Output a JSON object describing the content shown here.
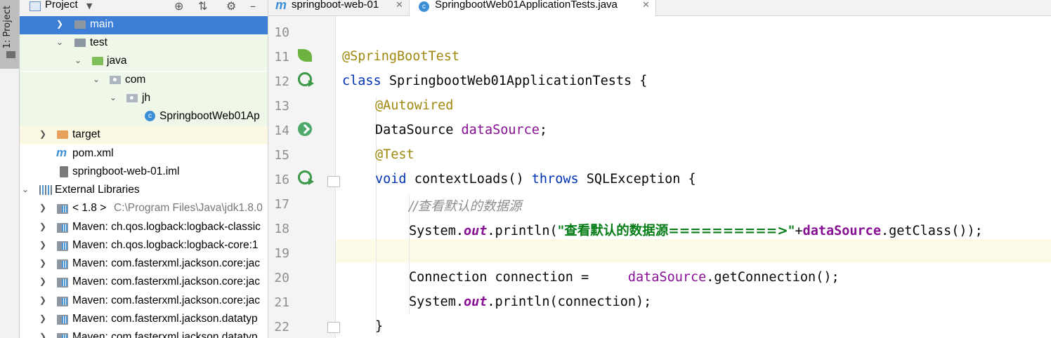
{
  "tool_window_strip": {
    "label": "1: Project"
  },
  "project_panel": {
    "title": "Project",
    "tree": [
      {
        "label": "main",
        "icon": "folder-icon",
        "expanded": false,
        "selected": true
      },
      {
        "label": "test",
        "icon": "folder-icon",
        "expanded": true
      },
      {
        "label": "java",
        "icon": "test-source-folder-icon",
        "expanded": true
      },
      {
        "label": "com",
        "icon": "package-icon",
        "expanded": true
      },
      {
        "label": "jh",
        "icon": "package-icon",
        "expanded": true
      },
      {
        "label": "SpringbootWeb01Ap",
        "icon": "class-icon"
      },
      {
        "label": "target",
        "icon": "excluded-folder-icon",
        "expanded": false
      },
      {
        "label": "pom.xml",
        "icon": "maven-icon"
      },
      {
        "label": "springboot-web-01.iml",
        "icon": "iml-file-icon"
      },
      {
        "label": "External Libraries",
        "icon": "libraries-icon",
        "expanded": true
      },
      {
        "label": "< 1.8 >",
        "detail": "C:\\Program Files\\Java\\jdk1.8.0",
        "icon": "jdk-icon"
      },
      {
        "label": "Maven: ch.qos.logback:logback-classic",
        "icon": "jar-icon"
      },
      {
        "label": "Maven: ch.qos.logback:logback-core:1",
        "icon": "jar-icon"
      },
      {
        "label": "Maven: com.fasterxml.jackson.core:jac",
        "icon": "jar-icon"
      },
      {
        "label": "Maven: com.fasterxml.jackson.core:jac",
        "icon": "jar-icon"
      },
      {
        "label": "Maven: com.fasterxml.jackson.core:jac",
        "icon": "jar-icon"
      },
      {
        "label": "Maven: com.fasterxml.jackson.datatyp",
        "icon": "jar-icon"
      },
      {
        "label": "Maven: com.fasterxml.jackson.datatyp",
        "icon": "jar-icon"
      }
    ]
  },
  "editor_tabs": [
    {
      "label": "springboot-web-01",
      "icon": "maven-icon",
      "active": false
    },
    {
      "label": "SpringbootWeb01ApplicationTests.java",
      "icon": "class-icon",
      "active": true
    }
  ],
  "code": {
    "line_numbers": [
      "10",
      "11",
      "12",
      "13",
      "14",
      "15",
      "16",
      "17",
      "18",
      "19",
      "20",
      "21",
      "22"
    ],
    "l11": {
      "ann": "@SpringBootTest"
    },
    "l12": {
      "kw": "class",
      "name": " SpringbootWeb01ApplicationTests {"
    },
    "l13": {
      "ann": "@Autowired"
    },
    "l14": {
      "type": "DataSource ",
      "field": "dataSource",
      "end": ";"
    },
    "l15": {
      "ann": "@Test"
    },
    "l16": {
      "kw": "void",
      "mid": " contextLoads() ",
      "kw2": "throws",
      "end": " SQLException {"
    },
    "l17": {
      "comment": "//查看默认的数据源"
    },
    "l18": {
      "a": "System.",
      "out": "out",
      "b": ".println(",
      "str": "\"查看默认的数据源==========>\"",
      "c": "+",
      "field": "dataSource",
      "d": ".getClass());"
    },
    "l20": {
      "a": "Connection connection =     ",
      "field": "dataSource",
      "b": ".getConnection();"
    },
    "l21": {
      "a": "System.",
      "out": "out",
      "b": ".println(connection);"
    },
    "l22": {
      "a": "}"
    }
  },
  "colors": {
    "selection": "#3d7fd6",
    "keyword": "#0033b3",
    "annotation": "#9e880d",
    "field": "#871094",
    "string": "#067d17",
    "comment": "#8c8c8c"
  }
}
